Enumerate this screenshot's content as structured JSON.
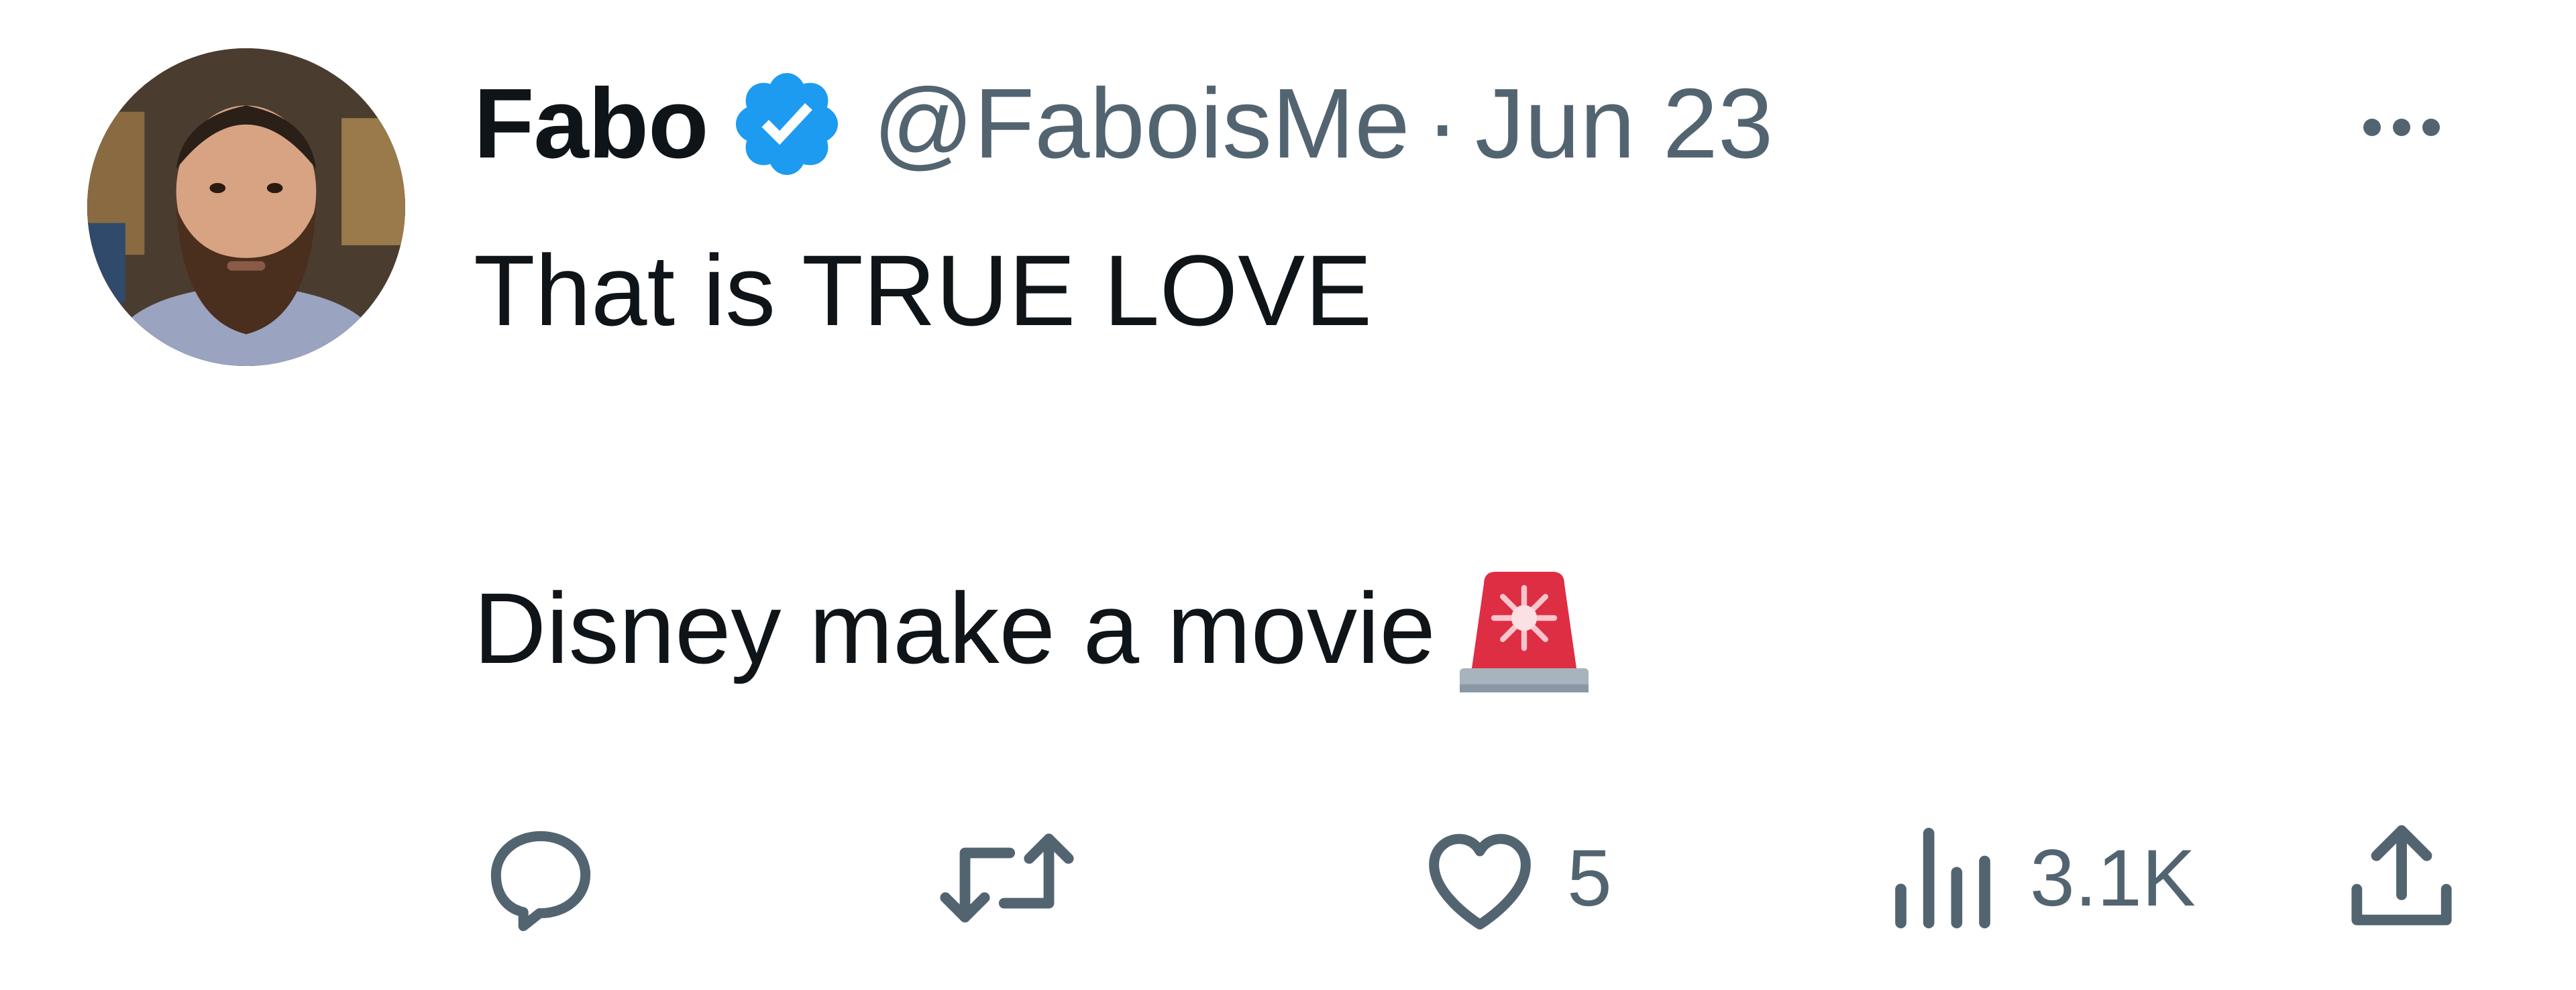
{
  "tweet": {
    "author": {
      "display_name": "Fabo",
      "handle": "@FaboisMe",
      "verified": true
    },
    "separator": "·",
    "date": "Jun 23",
    "text_lines": [
      "That is TRUE LOVE",
      "Disney make a movie"
    ],
    "emoji": "police-car-light",
    "actions": {
      "reply_count": "",
      "retweet_count": "",
      "like_count": "5",
      "views_count": "3.1K"
    }
  },
  "colors": {
    "text_primary": "#0f1419",
    "text_secondary": "#536471",
    "verified_blue": "#1d9bf0",
    "siren_red": "#dd2e44"
  }
}
